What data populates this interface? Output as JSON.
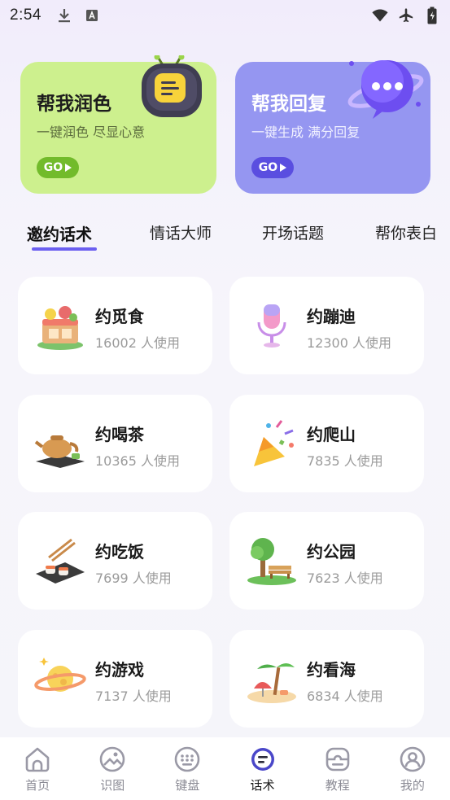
{
  "status_bar": {
    "time": "2:54",
    "left_icons": [
      "download-icon",
      "a-keyboard-icon"
    ],
    "right_icons": [
      "wifi-icon",
      "airplane-icon",
      "battery-charging-icon"
    ]
  },
  "hero_cards": [
    {
      "title": "帮我润色",
      "subtitle": "一键润色 尽显心意",
      "button": "GO",
      "color": "#cdf08e",
      "mascot": "tv-robot-icon"
    },
    {
      "title": "帮我回复",
      "subtitle": "一键生成 满分回复",
      "button": "GO",
      "color": "#9596f1",
      "mascot": "chat-bubble-planet-icon"
    }
  ],
  "tabs": [
    {
      "label": "邀约话术",
      "active": true
    },
    {
      "label": "情话大师",
      "active": false
    },
    {
      "label": "开场话题",
      "active": false
    },
    {
      "label": "帮你表白",
      "active": false
    }
  ],
  "topics": [
    {
      "name": "约觅食",
      "count": "16002 人使用",
      "icon": "food-cart-icon"
    },
    {
      "name": "约蹦迪",
      "count": "12300 人使用",
      "icon": "microphone-icon"
    },
    {
      "name": "约喝茶",
      "count": "10365 人使用",
      "icon": "teapot-icon"
    },
    {
      "name": "约爬山",
      "count": "7835 人使用",
      "icon": "party-popper-icon"
    },
    {
      "name": "约吃饭",
      "count": "7699 人使用",
      "icon": "sushi-chopsticks-icon"
    },
    {
      "name": "约公园",
      "count": "7623 人使用",
      "icon": "park-bench-icon"
    },
    {
      "name": "约游戏",
      "count": "7137 人使用",
      "icon": "planet-icon"
    },
    {
      "name": "约看海",
      "count": "6834 人使用",
      "icon": "beach-palm-icon"
    }
  ],
  "bottom_nav": [
    {
      "label": "首页",
      "icon": "home-icon",
      "active": false
    },
    {
      "label": "识图",
      "icon": "image-recognize-icon",
      "active": false
    },
    {
      "label": "键盘",
      "icon": "keyboard-icon",
      "active": false
    },
    {
      "label": "话术",
      "icon": "chat-script-icon",
      "active": true
    },
    {
      "label": "教程",
      "icon": "tutorial-icon",
      "active": false
    },
    {
      "label": "我的",
      "icon": "profile-icon",
      "active": false
    }
  ],
  "colors": {
    "accent": "#6b5ff0",
    "polish_go": "#72bb2b",
    "reply_go": "#5a4ee0",
    "inactive_nav": "#8b8b95"
  }
}
